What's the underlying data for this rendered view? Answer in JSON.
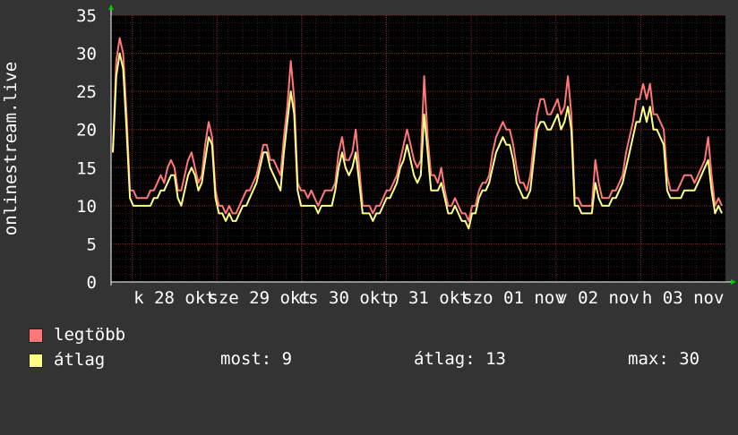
{
  "chart_data": {
    "type": "line",
    "ylabel": "onlinestream.live",
    "ylim": [
      0,
      35
    ],
    "yticks": [
      0,
      5,
      10,
      15,
      20,
      25,
      30,
      35
    ],
    "grid": true,
    "xtick_labels": [
      "k 28 okt",
      "sze 29 okt",
      "cs 30 okt",
      "p 31 okt",
      "szo 01 nov",
      "v 02 nov",
      "h 03 nov"
    ],
    "series": [
      {
        "name": "legtöbb",
        "color": "#ff7777",
        "values": [
          17,
          29,
          32,
          30,
          22,
          12,
          12,
          11,
          11,
          11,
          11,
          12,
          12,
          13,
          14,
          13,
          15,
          16,
          15,
          12,
          12,
          14,
          16,
          17,
          15,
          13,
          14,
          18,
          21,
          19,
          12,
          10,
          10,
          9,
          10,
          9,
          9,
          10,
          11,
          12,
          12,
          13,
          14,
          16,
          18,
          18,
          16,
          16,
          15,
          14,
          19,
          23,
          29,
          24,
          13,
          12,
          12,
          11,
          12,
          11,
          10,
          11,
          12,
          12,
          12,
          13,
          17,
          19,
          16,
          16,
          17,
          20,
          15,
          10,
          10,
          10,
          9,
          10,
          10,
          11,
          12,
          12,
          13,
          14,
          16,
          18,
          20,
          18,
          16,
          15,
          16,
          27,
          19,
          14,
          14,
          13,
          15,
          12,
          10,
          10,
          11,
          10,
          9,
          9,
          8,
          10,
          10,
          12,
          13,
          13,
          14,
          17,
          19,
          20,
          21,
          20,
          20,
          18,
          15,
          13,
          13,
          12,
          14,
          18,
          22,
          24,
          24,
          22,
          22,
          23,
          24,
          22,
          23,
          27,
          22,
          11,
          11,
          10,
          10,
          10,
          10,
          16,
          13,
          11,
          11,
          11,
          12,
          12,
          13,
          14,
          17,
          19,
          21,
          24,
          24,
          26,
          24,
          26,
          22,
          22,
          21,
          20,
          14,
          12,
          12,
          12,
          13,
          14,
          14,
          14,
          13,
          14,
          15,
          16,
          19,
          14,
          10,
          11,
          10
        ]
      },
      {
        "name": "átlag",
        "color": "#ffff88",
        "values": [
          17,
          27,
          30,
          28,
          20,
          11,
          10,
          10,
          10,
          10,
          10,
          10,
          11,
          11,
          12,
          12,
          13,
          14,
          14,
          11,
          10,
          12,
          14,
          15,
          14,
          12,
          13,
          16,
          19,
          18,
          11,
          9,
          9,
          8,
          9,
          8,
          8,
          9,
          10,
          10,
          11,
          12,
          13,
          15,
          17,
          17,
          15,
          14,
          13,
          12,
          17,
          21,
          25,
          22,
          12,
          10,
          10,
          10,
          10,
          10,
          9,
          10,
          10,
          10,
          10,
          12,
          15,
          17,
          15,
          14,
          15,
          17,
          13,
          9,
          9,
          9,
          8,
          9,
          9,
          10,
          11,
          11,
          12,
          13,
          15,
          16,
          18,
          16,
          14,
          13,
          14,
          22,
          17,
          12,
          12,
          12,
          13,
          11,
          9,
          9,
          10,
          9,
          8,
          8,
          7,
          9,
          9,
          11,
          12,
          12,
          13,
          15,
          17,
          18,
          19,
          18,
          18,
          16,
          13,
          12,
          11,
          11,
          12,
          16,
          20,
          21,
          21,
          20,
          20,
          21,
          22,
          20,
          21,
          23,
          20,
          10,
          10,
          9,
          9,
          9,
          9,
          13,
          11,
          10,
          10,
          10,
          11,
          11,
          12,
          13,
          15,
          17,
          19,
          21,
          21,
          23,
          21,
          23,
          20,
          20,
          19,
          18,
          12,
          11,
          11,
          11,
          11,
          12,
          12,
          12,
          12,
          13,
          14,
          15,
          16,
          12,
          9,
          10,
          9
        ]
      }
    ]
  },
  "legend": {
    "max_label": "legtöbb",
    "avg_label": "átlag",
    "max_color": "#ff7777",
    "avg_color": "#ffff88"
  },
  "stats": {
    "now": "most: 9",
    "avg": "átlag: 13",
    "max": "max: 30"
  }
}
